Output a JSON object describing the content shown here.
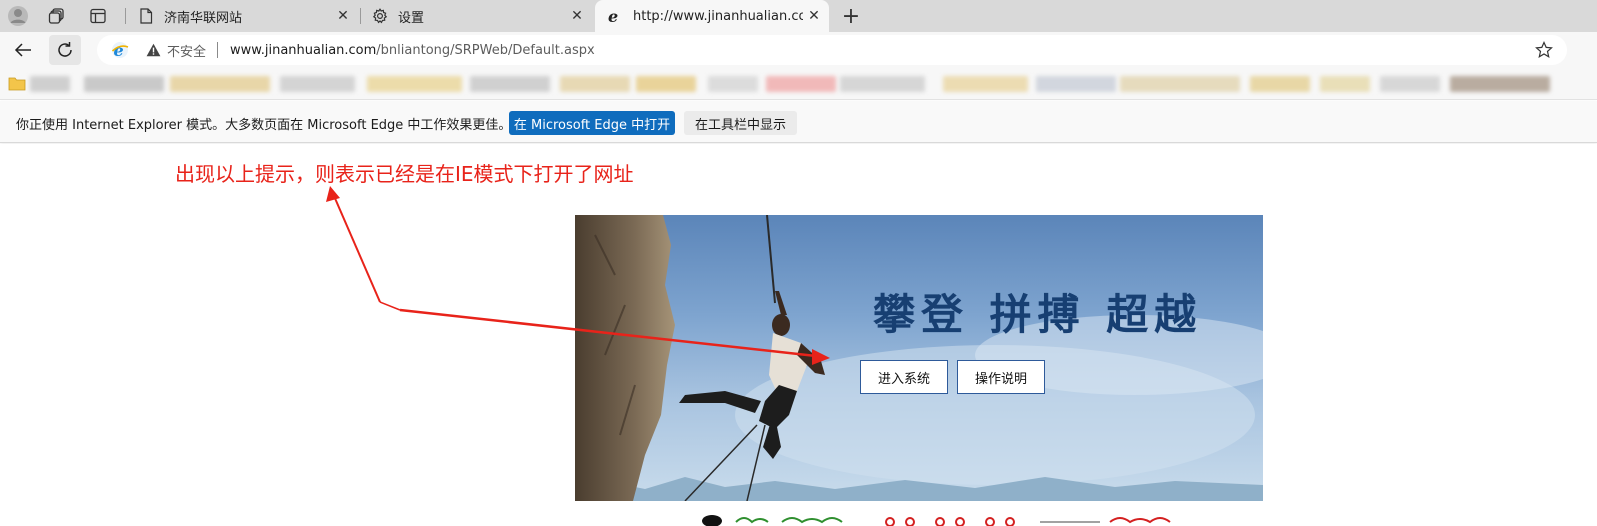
{
  "tabstrip": {
    "tabs": [
      {
        "title": "济南华联网站",
        "close": "✕",
        "active": false
      },
      {
        "title": "设置",
        "close": "✕",
        "active": false
      },
      {
        "title": "http://www.jinanhualian.com/bnl",
        "close": "✕",
        "active": true
      }
    ],
    "new_tab": "+"
  },
  "addressbar": {
    "security_label": "不安全",
    "url_host": "www.jinanhualian.com",
    "url_path": "/bnliantong/SRPWeb/Default.aspx"
  },
  "infobar": {
    "message": "你正使用 Internet Explorer 模式。大多数页面在 Microsoft Edge 中工作效果更佳。",
    "open_in_edge_label": "在 Microsoft Edge 中打开",
    "show_in_toolbar_label": "在工具栏中显示"
  },
  "page": {
    "annotation": "出现以上提示，则表示已经是在IE模式下打开了网址",
    "banner": {
      "slogan": "攀登 拼搏 超越",
      "enter_system_label": "进入系统",
      "instructions_label": "操作说明"
    }
  },
  "colors": {
    "annotation_red": "#e8231a",
    "edge_blue": "#0f6cbd",
    "slogan_blue": "#173f72"
  },
  "icons": {
    "profile": "avatar-icon",
    "workspaces": "workspaces-icon",
    "vertical_tabs": "vertical-tabs-icon",
    "page": "page-icon",
    "settings": "gear-icon",
    "ie": "ie-logo-icon",
    "back": "back-arrow-icon",
    "refresh": "refresh-icon",
    "warning": "warning-icon",
    "favorite": "star-icon",
    "folder": "folder-icon"
  }
}
